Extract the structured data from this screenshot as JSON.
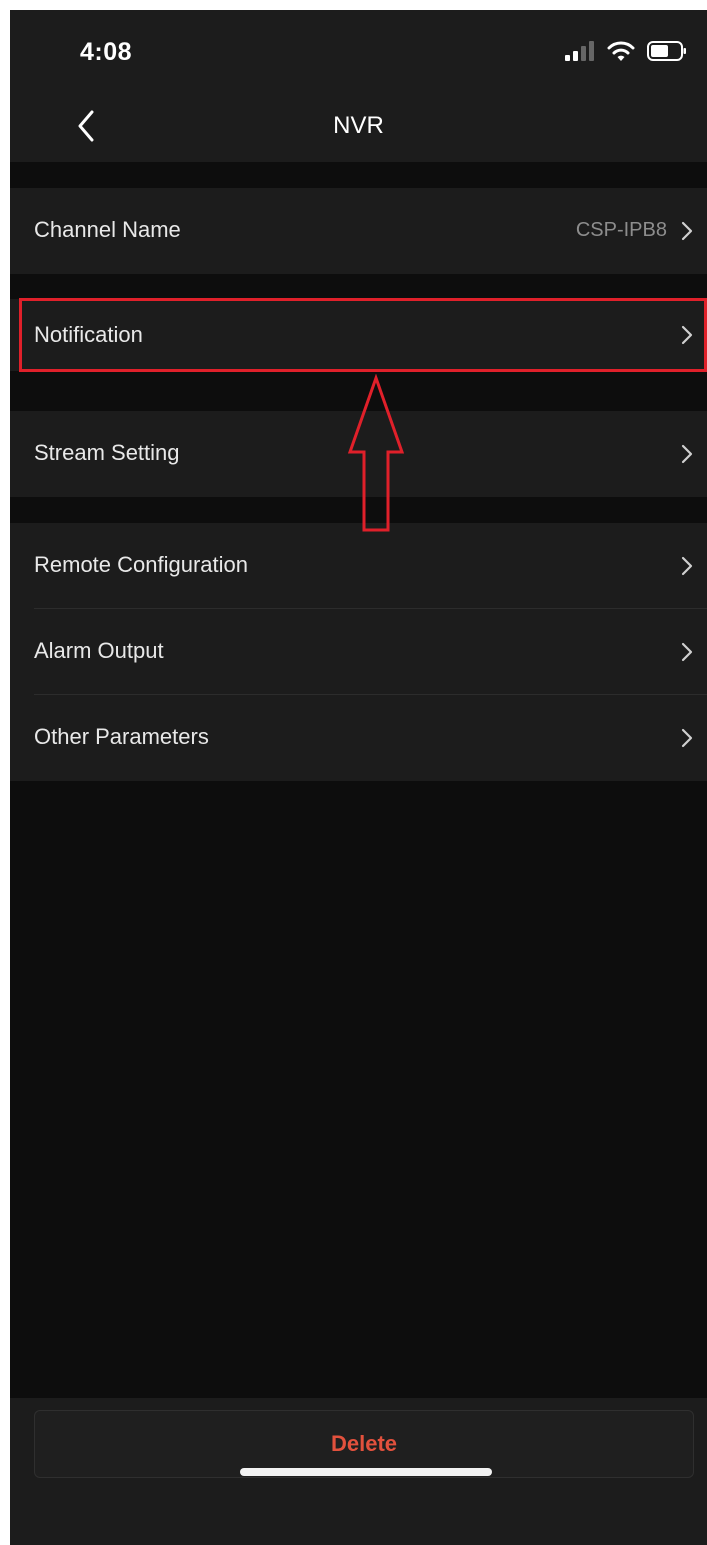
{
  "status_bar": {
    "time": "4:08",
    "icons": [
      "cellular-signal-icon",
      "wifi-icon",
      "battery-icon"
    ]
  },
  "nav": {
    "title": "NVR",
    "back_icon": "chevron-left-icon"
  },
  "rows": {
    "channel_name": {
      "label": "Channel Name",
      "value": "CSP-IPB8"
    },
    "notification": {
      "label": "Notification"
    },
    "stream_setting": {
      "label": "Stream Setting"
    },
    "remote_configuration": {
      "label": "Remote Configuration"
    },
    "alarm_output": {
      "label": "Alarm Output"
    },
    "other_parameters": {
      "label": "Other Parameters"
    }
  },
  "footer": {
    "delete_label": "Delete"
  },
  "colors": {
    "background": "#0d0d0d",
    "surface": "#1c1c1c",
    "text": "#e8e8e8",
    "secondary_text": "#8d8d8d",
    "destructive": "#e2513d",
    "annotation": "#e0202a"
  }
}
